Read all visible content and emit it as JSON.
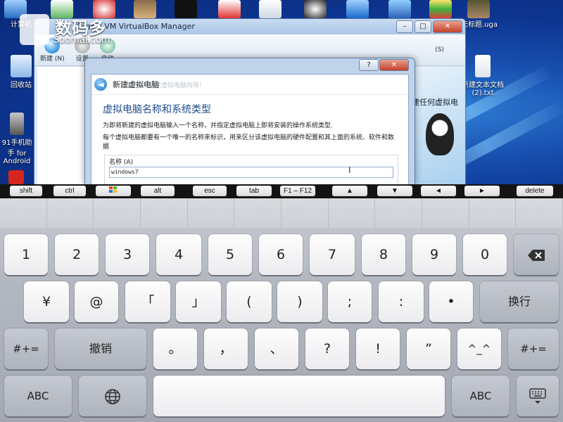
{
  "desktop": {
    "icons": [
      {
        "label": "计算机",
        "name": "computer-icon"
      },
      {
        "label": "回收站",
        "name": "recycle-bin-icon"
      },
      {
        "label": "91手机助手 for Android",
        "name": "phone-assistant-icon"
      },
      {
        "label": "无标题.uga",
        "name": "uga-file-icon"
      },
      {
        "label": "新建文本文档 (2).txt",
        "name": "text-file-icon"
      }
    ]
  },
  "watermark": {
    "cn": "数码多",
    "en": "Soomal.com"
  },
  "explorer": {
    "title": "Oracle VM VirtualBox Manager",
    "toolbar_new": "新建 (N)",
    "toolbar_settings": "设置",
    "toolbar_start": "启动",
    "side_text": "建任何虚拟电",
    "menu_hint": "(S)"
  },
  "dialog": {
    "help_btn": "?",
    "close_btn": "✕",
    "header_title": "新建虚拟电脑",
    "heading": "虚拟电脑名称和系统类型",
    "para1": "为即将新建的虚拟电脑输入一个名称，并指定虚拟电脑上即将安装的操作系统类型.",
    "para2": "每个虚拟电脑都要有一个唯一的名称来标识，用来区分该虚拟电脑的硬件配置和其上面的系统、软件和数据",
    "group_label": "名称 (A)",
    "name_value": "windows7",
    "ghost_text": "欢迎使用新建虚拟电脑向导!"
  },
  "modbar": {
    "keys": [
      "shift",
      "ctrl",
      "win",
      "alt",
      "esc",
      "tab",
      "F1 – F12",
      "▲",
      "▼",
      "◄",
      "►",
      "delete"
    ]
  },
  "keyboard": {
    "row1": [
      "1",
      "2",
      "3",
      "4",
      "5",
      "6",
      "7",
      "8",
      "9",
      "0"
    ],
    "row2": [
      "¥",
      "@",
      "「",
      "」",
      "(",
      ")",
      ";",
      ":",
      "•"
    ],
    "row2_return": "换行",
    "row3_left": "#+=",
    "row3_undo": "撤销",
    "row3": [
      "。",
      "，",
      "、",
      "?",
      "!",
      "”",
      "^_^"
    ],
    "row3_right": "#+=",
    "abc_left": "ABC",
    "abc_right": "ABC"
  },
  "colors": {
    "desktop": "#0d3591",
    "dialog_heading": "#1f4a8a",
    "keyboard_bg": "#b4b8c1"
  }
}
